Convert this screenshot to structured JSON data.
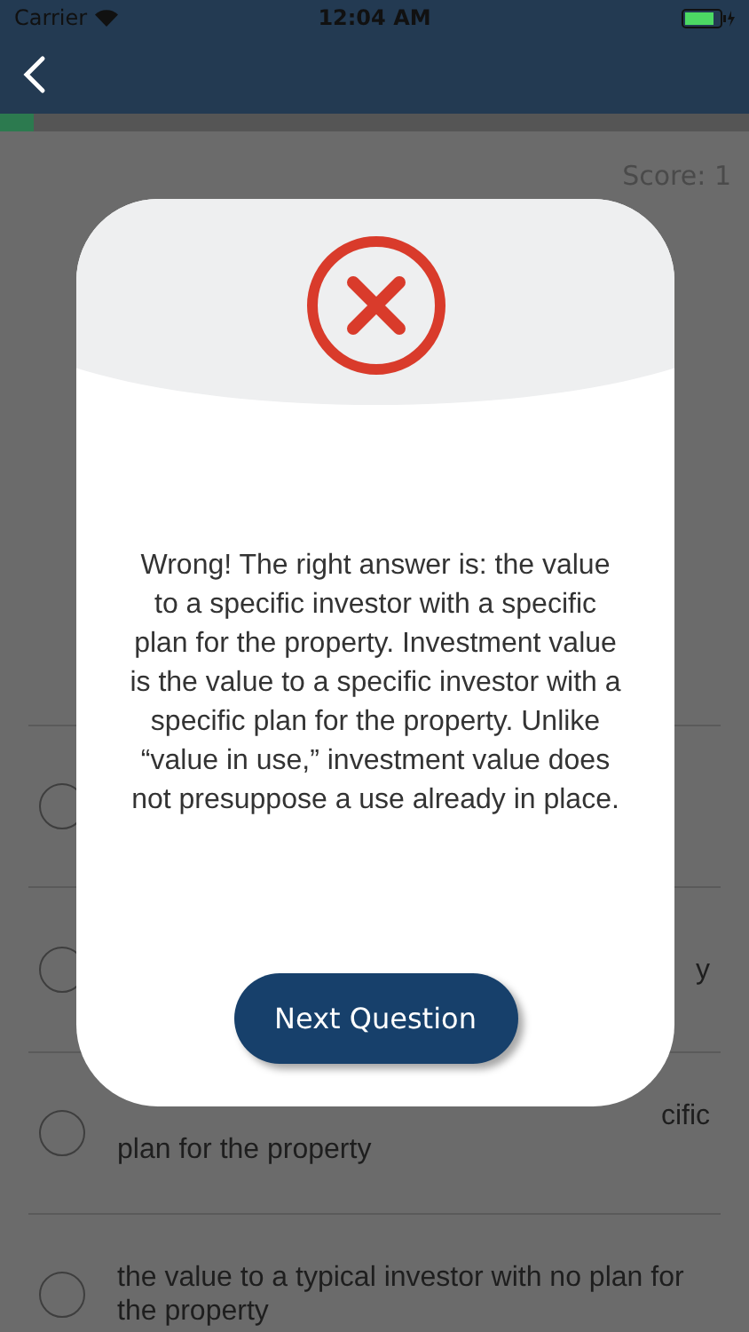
{
  "status_bar": {
    "carrier": "Carrier",
    "time": "12:04 AM"
  },
  "progress": {
    "level": 0.045
  },
  "score": "Score: 1",
  "options": [
    {
      "kind": "hidden",
      "selected": false
    },
    {
      "kind": "covered",
      "selected": false,
      "lines": [
        "y"
      ]
    },
    {
      "kind": "covered",
      "selected": false,
      "lines": [
        "cific",
        "plan for the property"
      ]
    },
    {
      "kind": "full",
      "selected": false,
      "lines": [
        "the value to a typical investor with no plan for the property"
      ]
    }
  ],
  "dialog": {
    "kind": "wrong",
    "message": "Wrong! The right answer is: the value to a specific investor with a specific plan for the property. Investment value is the value to a specific investor with a specific plan for the property. Unlike “value in use,” investment value does not presuppose a use already in place.",
    "button": "Next Question"
  }
}
